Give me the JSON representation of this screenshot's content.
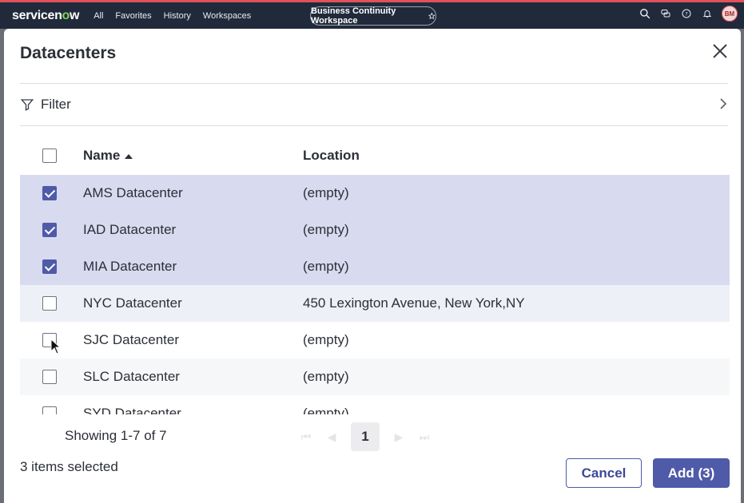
{
  "nav": {
    "logo_prefix": "servicen",
    "logo_o": "o",
    "logo_suffix": "w",
    "links": [
      "All",
      "Favorites",
      "History",
      "Workspaces"
    ],
    "workspace": "Business Continuity Workspace",
    "avatar": "BM"
  },
  "modal": {
    "title": "Datacenters",
    "filter_label": "Filter"
  },
  "table": {
    "headers": {
      "name": "Name",
      "location": "Location"
    },
    "rows": [
      {
        "name": "AMS Datacenter",
        "location": "(empty)",
        "checked": true
      },
      {
        "name": "IAD Datacenter",
        "location": "(empty)",
        "checked": true
      },
      {
        "name": "MIA Datacenter",
        "location": "(empty)",
        "checked": true
      },
      {
        "name": "NYC Datacenter",
        "location": "450 Lexington Avenue, New York,NY",
        "checked": false
      },
      {
        "name": "SJC Datacenter",
        "location": "(empty)",
        "checked": false
      },
      {
        "name": "SLC Datacenter",
        "location": "(empty)",
        "checked": false
      },
      {
        "name": "SYD Datacenter",
        "location": "(empty)",
        "checked": false
      }
    ]
  },
  "footer": {
    "showing": "Showing 1-7 of 7",
    "current_page": "1",
    "selected": "3 items selected",
    "cancel": "Cancel",
    "add": "Add (3)"
  },
  "colors": {
    "nav_bg": "#212a3a",
    "accent": "#4f5aa8",
    "selected_row": "#d8daf0"
  }
}
